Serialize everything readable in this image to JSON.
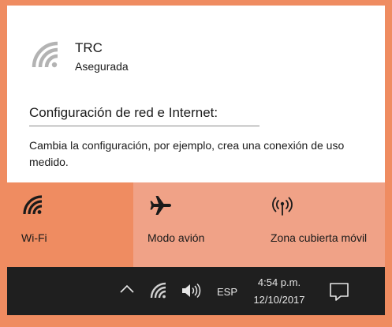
{
  "network": {
    "name": "TRC",
    "status": "Asegurada",
    "icon": "wifi-icon"
  },
  "settings": {
    "link": "Configuración de red e Internet:",
    "description": "Cambia la configuración, por ejemplo, crea una conexión de uso medido."
  },
  "quick_actions": [
    {
      "label": "Wi-Fi",
      "icon": "wifi-icon",
      "active": true
    },
    {
      "label": "Modo avión",
      "icon": "airplane-icon",
      "active": false
    },
    {
      "label": "Zona cubierta móvil",
      "icon": "mobile-hotspot-icon",
      "active": false
    }
  ],
  "taskbar": {
    "language": "ESP",
    "time": "4:54 p.m.",
    "date": "12/10/2017",
    "icons": [
      "chevron-up-icon",
      "wifi-icon",
      "volume-icon",
      "action-center-icon"
    ]
  },
  "colors": {
    "background": "#ef8c61",
    "tile_active": "#ef8c61",
    "tile_inactive": "#f0a287",
    "taskbar": "#1f1f1f"
  }
}
